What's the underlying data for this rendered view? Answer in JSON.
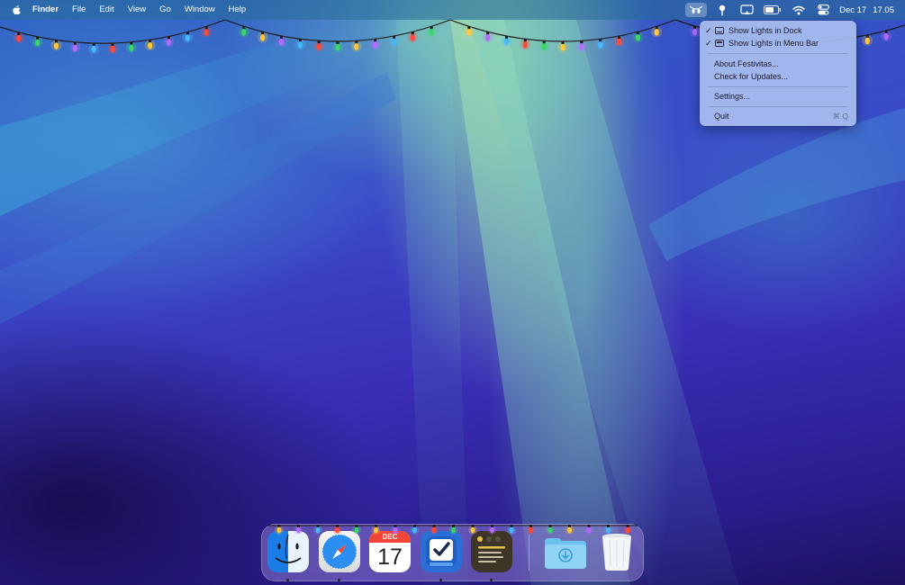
{
  "menubar": {
    "apple_icon": "apple-logo",
    "items": [
      "Finder",
      "File",
      "Edit",
      "View",
      "Go",
      "Window",
      "Help"
    ],
    "status_icons": [
      "festivitas-lights-icon",
      "location-pin-icon",
      "screen-mirroring-icon",
      "battery-icon",
      "wifi-icon",
      "control-center-icon"
    ],
    "date": "Dec 17",
    "time": "17.05"
  },
  "dropdown": {
    "items": [
      {
        "label": "Show Lights in Dock",
        "checked": true,
        "icon": "dock-window-icon"
      },
      {
        "label": "Show Lights in Menu Bar",
        "checked": true,
        "icon": "menubar-window-icon"
      },
      {
        "label": "About Festivitas..."
      },
      {
        "label": "Check for Updates..."
      },
      {
        "label": "Settings..."
      },
      {
        "label": "Quit",
        "shortcut": "⌘ Q"
      }
    ],
    "checkmark": "✓"
  },
  "dock": {
    "apps": [
      "Finder",
      "Safari",
      "Calendar",
      "Tasks",
      "Notes",
      "Downloads",
      "Trash"
    ],
    "calendar": {
      "month": "DEC",
      "day": "17"
    }
  },
  "colors": {
    "light_red": "#ff4a3a",
    "light_green": "#3bd66a",
    "light_yellow": "#ffc83a",
    "light_purple": "#b46bff",
    "light_blue": "#4ab8ff",
    "menu_accent": "#a8bef0"
  }
}
